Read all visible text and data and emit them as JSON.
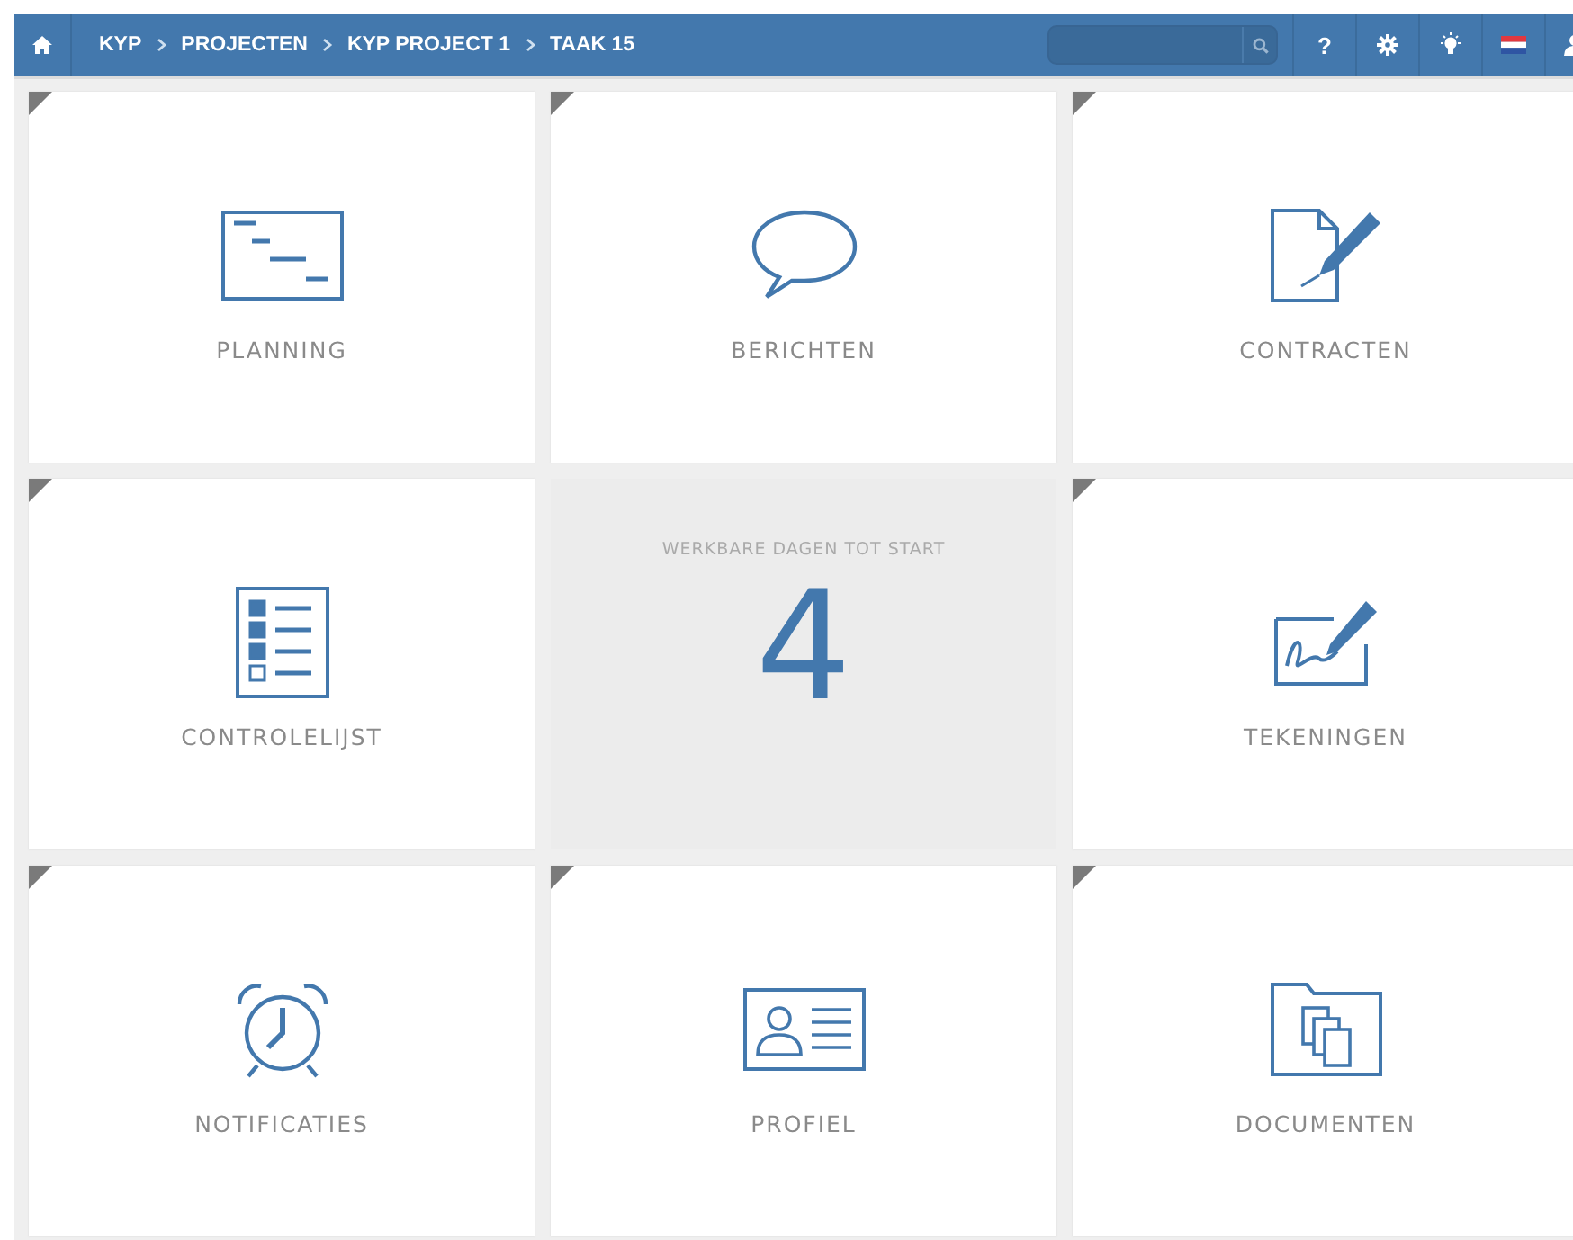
{
  "topbar": {
    "breadcrumbs": [
      "KYP",
      "PROJECTEN",
      "KYP PROJECT 1",
      "TAAK 15"
    ],
    "help": "?"
  },
  "tile_rows": [
    {
      "tiles": [
        {
          "kind": "link",
          "label": "PLANNING"
        },
        {
          "kind": "link",
          "label": "BERICHTEN"
        },
        {
          "kind": "link",
          "label": "CONTRACTEN"
        }
      ]
    },
    {
      "tiles": [
        {
          "kind": "link",
          "label": "CONTROLELIJST"
        },
        {
          "kind": "counter",
          "label": "WERKBARE DAGEN TOT START",
          "value": "4"
        },
        {
          "kind": "link",
          "label": "TEKENINGEN"
        }
      ]
    },
    {
      "tiles": [
        {
          "kind": "link",
          "label": "NOTIFICATIES"
        },
        {
          "kind": "link",
          "label": "PROFIEL"
        },
        {
          "kind": "link",
          "label": "DOCUMENTEN"
        }
      ]
    }
  ]
}
